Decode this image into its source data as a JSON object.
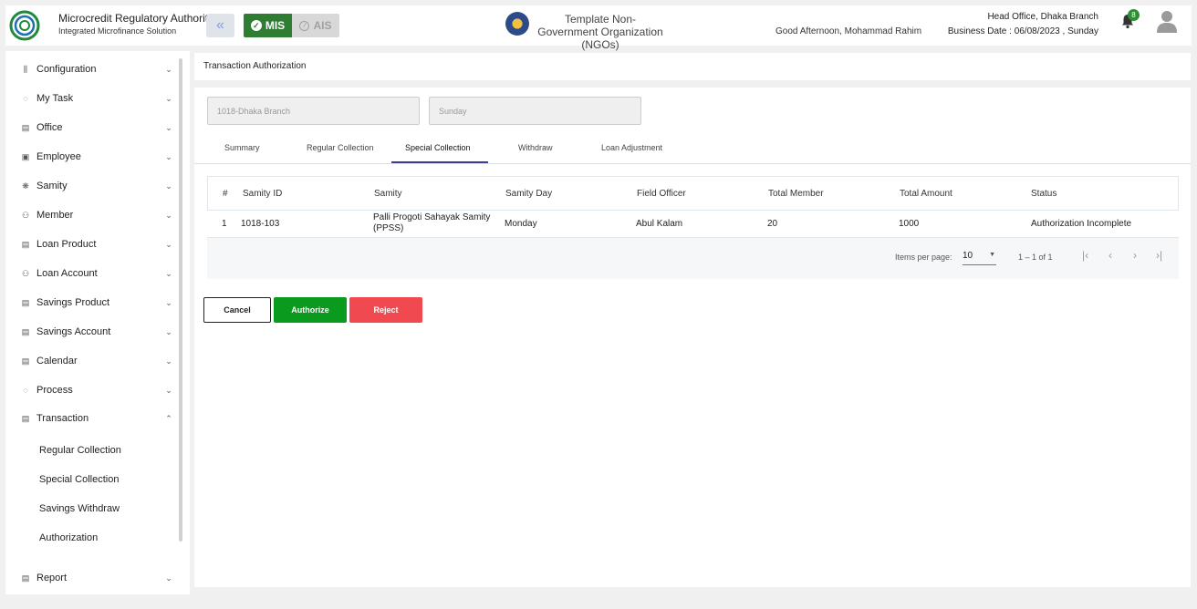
{
  "header": {
    "brand_title": "Microcredit Regulatory Authority",
    "brand_sub": "Integrated Microfinance Solution",
    "logo_text": "Microcredit Regulatory Authority",
    "mis_label": "MIS",
    "ais_label": "AIS",
    "ngo_name": "Template Non-Government Organization (NGOs)",
    "greeting": "Good Afternoon, Mohammad Rahim",
    "branch": "Head Office, Dhaka Branch",
    "business_date": "Business Date : 06/08/2023 , Sunday",
    "notification_count": "8",
    "colors": {
      "accent": "#2f7d32",
      "tab_active": "#3b3f8f"
    }
  },
  "sidebar": {
    "items": [
      {
        "label": "Configuration",
        "icon": "sliders-icon"
      },
      {
        "label": "My Task",
        "icon": "spinner-icon"
      },
      {
        "label": "Office",
        "icon": "building-icon"
      },
      {
        "label": "Employee",
        "icon": "id-card-icon"
      },
      {
        "label": "Samity",
        "icon": "group-icon"
      },
      {
        "label": "Member",
        "icon": "people-icon"
      },
      {
        "label": "Loan Product",
        "icon": "building-icon"
      },
      {
        "label": "Loan Account",
        "icon": "people-icon"
      },
      {
        "label": "Savings Product",
        "icon": "building-icon"
      },
      {
        "label": "Savings Account",
        "icon": "building-icon"
      },
      {
        "label": "Calendar",
        "icon": "building-icon"
      },
      {
        "label": "Process",
        "icon": "spinner-icon"
      },
      {
        "label": "Transaction",
        "icon": "building-icon"
      }
    ],
    "transaction_subitems": [
      "Regular Collection",
      "Special Collection",
      "Savings Withdraw",
      "Authorization"
    ],
    "report": {
      "label": "Report",
      "icon": "building-icon"
    }
  },
  "main": {
    "breadcrumb": "Transaction Authorization",
    "branch_field": "1018-Dhaka Branch",
    "day_field": "Sunday",
    "tabs": [
      "Summary",
      "Regular Collection",
      "Special Collection",
      "Withdraw",
      "Loan Adjustment"
    ],
    "active_tab": "Special Collection",
    "table": {
      "headers": [
        "#",
        "Samity ID",
        "Samity",
        "Samity Day",
        "Field Officer",
        "Total Member",
        "Total Amount",
        "Status"
      ],
      "rows": [
        [
          "1",
          "1018-103",
          "Palli Progoti Sahayak Samity (PPSS)",
          "Monday",
          "Abul Kalam",
          "20",
          "1000",
          "Authorization Incomplete"
        ]
      ]
    },
    "pager": {
      "items_per_page_label": "Items per page:",
      "items_per_page": "10",
      "range": "1 – 1 of 1"
    },
    "buttons": {
      "cancel": "Cancel",
      "authorize": "Authorize",
      "reject": "Reject"
    }
  }
}
